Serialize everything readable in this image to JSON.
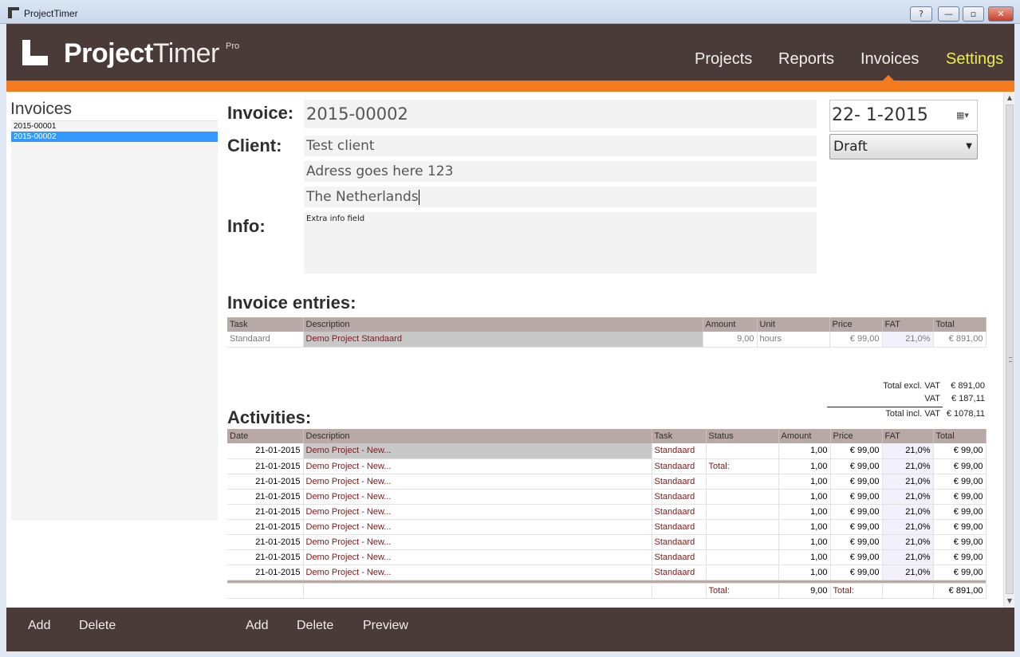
{
  "window": {
    "title": "ProjectTimer",
    "help_label": "?",
    "minimize_label": "—",
    "maximize_label": "▫",
    "close_label": "✕"
  },
  "brand": {
    "name_bold": "Project",
    "name_light": "Timer",
    "edition": "Pro"
  },
  "nav": {
    "projects": "Projects",
    "reports": "Reports",
    "invoices": "Invoices",
    "settings": "Settings",
    "active": "Invoices",
    "settings_color": "#e6ee4a"
  },
  "colors": {
    "header": "#4a3a38",
    "accent": "#f37a1f",
    "table_header": "#b9a9a6",
    "selection": "#3399ff"
  },
  "sidebar": {
    "title": "Invoices",
    "items": [
      "2015-00001",
      "2015-00002"
    ],
    "selected": "2015-00002"
  },
  "invoice": {
    "invoice_label": "Invoice:",
    "number": "2015-00002",
    "client_label": "Client:",
    "client_name": "Test client",
    "address_line": "Adress goes here 123",
    "country": "The Netherlands",
    "info_label": "Info:",
    "info_text": "Extra info field",
    "date": "22- 1-2015",
    "calendar_icon": "calendar-icon",
    "status": "Draft"
  },
  "entries": {
    "heading": "Invoice entries:",
    "columns": [
      "Task",
      "Description",
      "Amount",
      "Unit",
      "Price",
      "FAT",
      "Total"
    ],
    "rows": [
      {
        "task": "Standaard",
        "description": "Demo Project Standaard",
        "amount": "9,00",
        "unit": "hours",
        "price": "€ 99,00",
        "fat": "21,0%",
        "total": "€ 891,00"
      }
    ],
    "totals": {
      "excl_label": "Total excl. VAT",
      "excl_value": "€ 891,00",
      "vat_label": "VAT",
      "vat_value": "€ 187,11",
      "incl_label": "Total incl. VAT",
      "incl_value": "€ 1078,11"
    }
  },
  "activities": {
    "heading": "Activities:",
    "columns": [
      "Date",
      "Description",
      "Task",
      "Status",
      "Amount",
      "Price",
      "FAT",
      "Total"
    ],
    "rows": [
      {
        "date": "21-01-2015",
        "description": "Demo Project - New...",
        "task": "Standaard",
        "status": "",
        "amount": "1,00",
        "price": "€ 99,00",
        "fat": "21,0%",
        "total": "€ 99,00"
      },
      {
        "date": "21-01-2015",
        "description": "Demo Project - New...",
        "task": "Standaard",
        "status": "Total:",
        "amount": "1,00",
        "price": "€ 99,00",
        "fat": "21,0%",
        "total": "€ 99,00"
      },
      {
        "date": "21-01-2015",
        "description": "Demo Project - New...",
        "task": "Standaard",
        "status": "",
        "amount": "1,00",
        "price": "€ 99,00",
        "fat": "21,0%",
        "total": "€ 99,00"
      },
      {
        "date": "21-01-2015",
        "description": "Demo Project - New...",
        "task": "Standaard",
        "status": "",
        "amount": "1,00",
        "price": "€ 99,00",
        "fat": "21,0%",
        "total": "€ 99,00"
      },
      {
        "date": "21-01-2015",
        "description": "Demo Project - New...",
        "task": "Standaard",
        "status": "",
        "amount": "1,00",
        "price": "€ 99,00",
        "fat": "21,0%",
        "total": "€ 99,00"
      },
      {
        "date": "21-01-2015",
        "description": "Demo Project - New...",
        "task": "Standaard",
        "status": "",
        "amount": "1,00",
        "price": "€ 99,00",
        "fat": "21,0%",
        "total": "€ 99,00"
      },
      {
        "date": "21-01-2015",
        "description": "Demo Project - New...",
        "task": "Standaard",
        "status": "",
        "amount": "1,00",
        "price": "€ 99,00",
        "fat": "21,0%",
        "total": "€ 99,00"
      },
      {
        "date": "21-01-2015",
        "description": "Demo Project - New...",
        "task": "Standaard",
        "status": "",
        "amount": "1,00",
        "price": "€ 99,00",
        "fat": "21,0%",
        "total": "€ 99,00"
      },
      {
        "date": "21-01-2015",
        "description": "Demo Project - New...",
        "task": "Standaard",
        "status": "",
        "amount": "1,00",
        "price": "€ 99,00",
        "fat": "21,0%",
        "total": "€ 99,00"
      }
    ],
    "footer": {
      "status_label": "Total:",
      "amount": "9,00",
      "price_label": "Total:",
      "total": "€ 891,00"
    }
  },
  "footer": {
    "left_add": "Add",
    "left_delete": "Delete",
    "main_add": "Add",
    "main_delete": "Delete",
    "main_preview": "Preview"
  }
}
